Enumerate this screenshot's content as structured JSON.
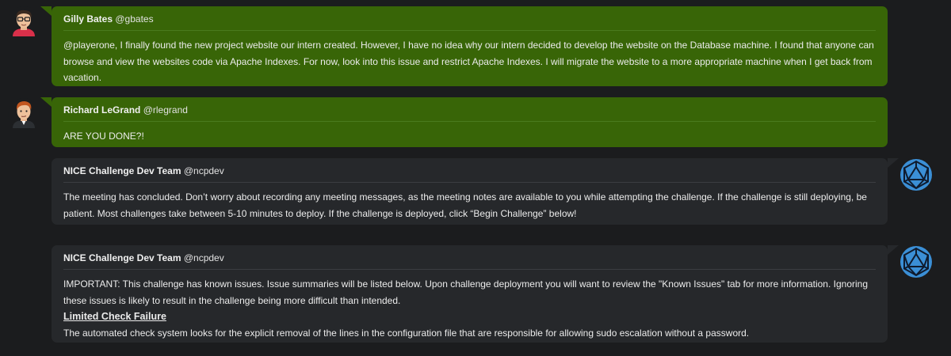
{
  "messages": [
    {
      "name": "Gilly Bates",
      "handle": "@gbates",
      "avatar": "male-avatar-glasses-icon",
      "text": "@playerone, I finally found the new project website our intern created. However, I have no idea why our intern decided to develop the website on the Database machine. I found that anyone can browse and view the websites code via Apache Indexes. For now, look into this issue and restrict Apache Indexes. I will migrate the website to a more appropriate machine when I get back from vacation."
    },
    {
      "name": "Richard LeGrand",
      "handle": "@rlegrand",
      "avatar": "male-avatar-redhair-icon",
      "text": "ARE YOU DONE?!"
    },
    {
      "name": "NICE Challenge Dev Team",
      "handle": "@ncpdev",
      "avatar": "nice-d20-logo-icon",
      "text": "The meeting has concluded. Don’t worry about recording any meeting messages, as the meeting notes are available to you while attempting the challenge. If the challenge is still deploying, be patient. Most challenges take between 5-10 minutes to deploy. If the challenge is deployed, click “Begin Challenge” below!"
    },
    {
      "name": "NICE Challenge Dev Team",
      "handle": "@ncpdev",
      "avatar": "nice-d20-logo-icon",
      "text": "IMPORTANT: This challenge has known issues. Issue summaries will be listed below. Upon challenge deployment you will want to review the \"Known Issues\" tab for more information. Ignoring these issues is likely to result in the challenge being more difficult than intended.",
      "issue_title": "Limited Check Failure",
      "issue_text": "The automated check system looks for the explicit removal of the lines in the configuration file that are responsible for allowing sudo escalation without a password."
    }
  ],
  "colors": {
    "background": "#1b1c1e",
    "coworker_bubble": "#386507",
    "system_bubble": "#26282b",
    "logo_blue": "#3b8fd6"
  }
}
